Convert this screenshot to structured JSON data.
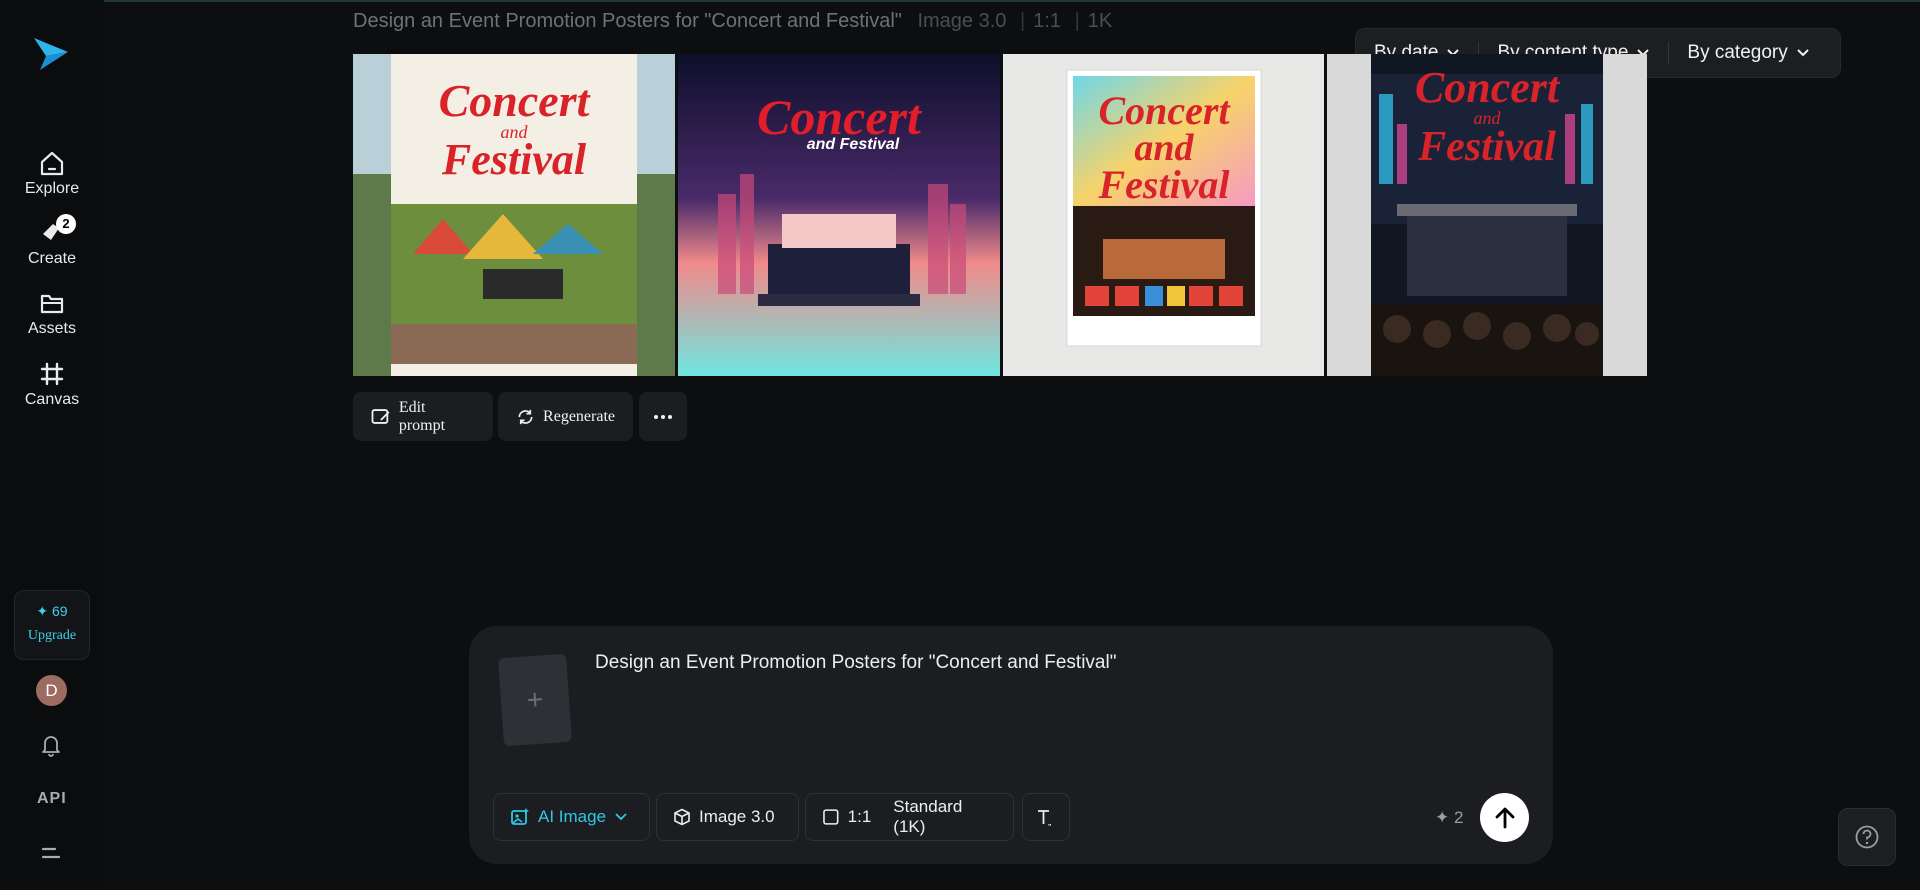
{
  "header": {
    "prompt_title": "Design an Event Promotion Posters for \"Concert and Festival\"",
    "model": "Image 3.0",
    "ratio": "1:1",
    "resolution": "1K"
  },
  "filters": [
    {
      "label": "By date"
    },
    {
      "label": "By content type"
    },
    {
      "label": "By category"
    }
  ],
  "sidebar": {
    "items": [
      {
        "label": "Explore",
        "icon": "home-icon"
      },
      {
        "label": "Create",
        "icon": "create-icon",
        "badge": "2"
      },
      {
        "label": "Assets",
        "icon": "folder-icon"
      },
      {
        "label": "Canvas",
        "icon": "canvas-icon"
      }
    ],
    "credits": "69",
    "upgrade_label": "Upgrade",
    "avatar_initial": "D",
    "api_label": "API"
  },
  "posters": [
    {
      "title_line1": "Concert",
      "title_and": "and",
      "title_line2": "Festival"
    },
    {
      "title_line1": "Concert",
      "title_and": "and Festival",
      "title_line2": ""
    },
    {
      "title_line1": "Concert",
      "title_and": "and",
      "title_line2": "Festival"
    },
    {
      "title_line1": "Concert",
      "title_and": "and",
      "title_line2": "Festival"
    }
  ],
  "actions": {
    "edit_prompt": "Edit prompt",
    "regenerate": "Regenerate"
  },
  "composer": {
    "prompt_text": "Design an Event Promotion Posters for \"Concert and Festival\"",
    "mode": "AI Image",
    "model": "Image 3.0",
    "ratio": "1:1",
    "quality": "Standard (1K)",
    "cost": "2"
  },
  "colors": {
    "accent": "#2ec8e6",
    "poster_red": "#d8232a"
  }
}
